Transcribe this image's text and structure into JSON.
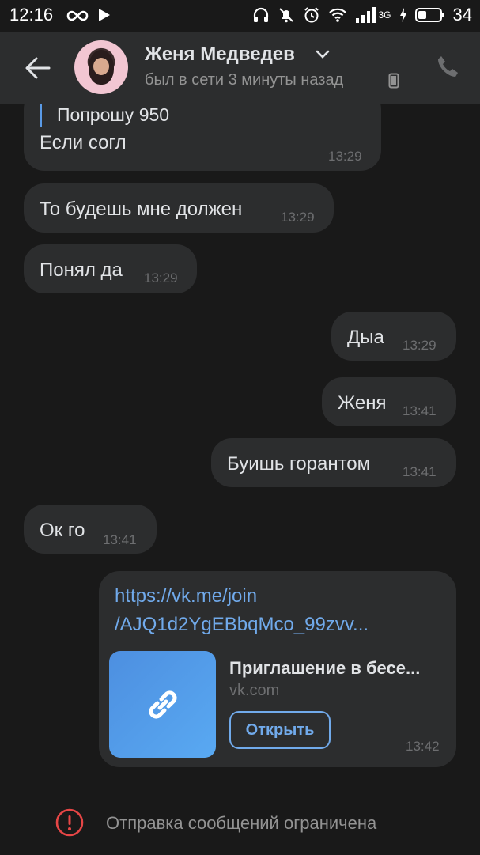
{
  "status_bar": {
    "time": "12:16",
    "network": "3G",
    "battery": "34"
  },
  "header": {
    "contact_name": "Женя Медведев",
    "status": "был в сети 3 минуты назад"
  },
  "messages": [
    {
      "side": "in",
      "quote": "Попрошу 950",
      "text": "Если согл",
      "time": "13:29"
    },
    {
      "side": "in",
      "text": "То будешь мне должен",
      "time": "13:29"
    },
    {
      "side": "in",
      "text": "Понял да",
      "time": "13:29"
    },
    {
      "side": "out",
      "text": "Дыа",
      "time": "13:29"
    },
    {
      "side": "out",
      "text": "Женя",
      "time": "13:41"
    },
    {
      "side": "out",
      "text": "Буишь горантом",
      "time": "13:41"
    },
    {
      "side": "in",
      "text": "Ок го",
      "time": "13:41"
    }
  ],
  "link_message": {
    "url_line1": "https://vk.me/join",
    "url_line2": "/AJQ1d2YgEBbqMco_99zvv...",
    "title": "Приглашение в бесе...",
    "domain": "vk.com",
    "button_label": "Открыть",
    "time": "13:42"
  },
  "footer": {
    "restriction_text": "Отправка сообщений ограничена"
  },
  "colors": {
    "background": "#191919",
    "bubble": "#2c2d2e",
    "accent": "#71aaeb",
    "warning": "#e64646"
  }
}
